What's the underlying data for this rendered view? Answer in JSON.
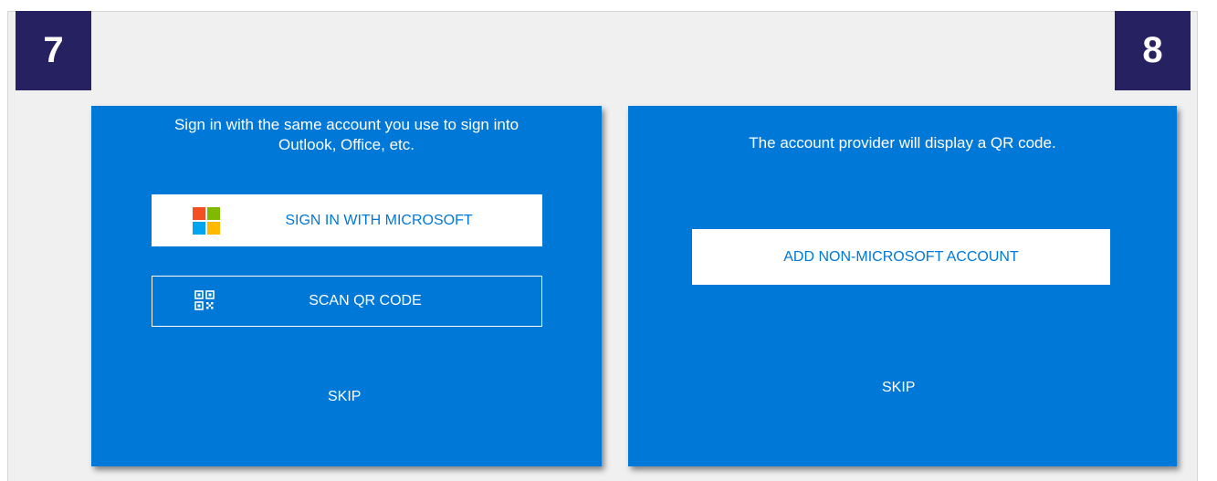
{
  "steps": {
    "left_number": "7",
    "right_number": "8"
  },
  "left_panel": {
    "instruction_line1": "Sign in with the same account you use to sign into",
    "instruction_line2": "Outlook, Office, etc.",
    "sign_in_button_label": "SIGN IN WITH MICROSOFT",
    "sign_in_icon": "microsoft-logo-icon",
    "scan_button_label": "SCAN QR CODE",
    "scan_icon": "qr-code-icon",
    "skip_label": "SKIP"
  },
  "right_panel": {
    "instruction": "The account provider will display a QR code.",
    "add_account_button_label": "ADD NON-MICROSOFT ACCOUNT",
    "skip_label": "SKIP"
  },
  "colors": {
    "panel_background": "#0078d7",
    "badge_background": "#262262",
    "ms_red": "#f25022",
    "ms_green": "#7fba00",
    "ms_blue": "#00a4ef",
    "ms_yellow": "#ffb900"
  }
}
